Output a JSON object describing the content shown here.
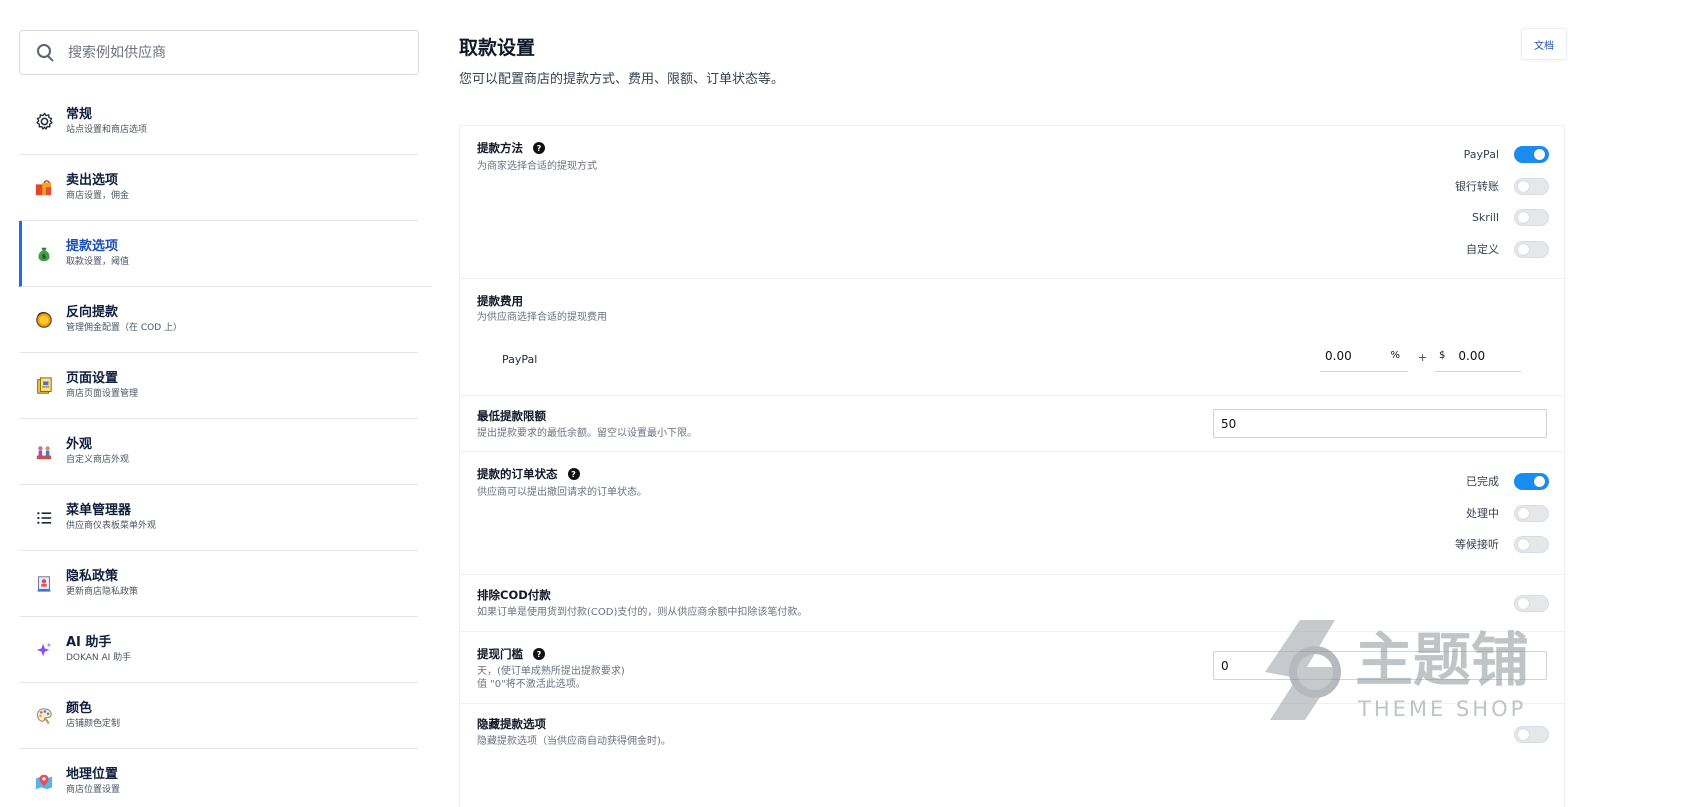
{
  "search": {
    "placeholder": "搜索例如供应商"
  },
  "sidebar": {
    "items": [
      {
        "title": "常规",
        "subtitle": "站点设置和商店选项",
        "icon": "gear-icon",
        "active": false
      },
      {
        "title": "卖出选项",
        "subtitle": "商店设置，佣金",
        "icon": "shopping-bags-icon",
        "active": false
      },
      {
        "title": "提款选项",
        "subtitle": "取款设置，阈值",
        "icon": "money-bag-icon",
        "active": true
      },
      {
        "title": "反向提款",
        "subtitle": "管理佣金配置（在 COD 上）",
        "icon": "coin-icon",
        "active": false
      },
      {
        "title": "页面设置",
        "subtitle": "商店页面设置管理",
        "icon": "pages-icon",
        "active": false
      },
      {
        "title": "外观",
        "subtitle": "自定义商店外观",
        "icon": "palette-people-icon",
        "active": false
      },
      {
        "title": "菜单管理器",
        "subtitle": "供应商仪表板菜单外观",
        "icon": "list-icon",
        "active": false
      },
      {
        "title": "隐私政策",
        "subtitle": "更新商店隐私政策",
        "icon": "privacy-icon",
        "active": false
      },
      {
        "title": "AI 助手",
        "subtitle": "DOKAN AI 助手",
        "icon": "sparkle-icon",
        "active": false
      },
      {
        "title": "颜色",
        "subtitle": "店铺颜色定制",
        "icon": "color-palette-icon",
        "active": false
      },
      {
        "title": "地理位置",
        "subtitle": "商店位置设置",
        "icon": "map-pin-icon",
        "active": false
      }
    ]
  },
  "header": {
    "title": "取款设置",
    "description": "您可以配置商店的提款方式、费用、限额、订单状态等。",
    "doc_button": "文档"
  },
  "sections": {
    "methods": {
      "title": "提款方法",
      "description": "为商家选择合适的提现方式",
      "options": [
        {
          "label": "PayPal",
          "enabled": true
        },
        {
          "label": "银行转账",
          "enabled": false
        },
        {
          "label": "Skrill",
          "enabled": false
        },
        {
          "label": "自定义",
          "enabled": false
        }
      ]
    },
    "fees": {
      "title": "提款费用",
      "description": "为供应商选择合适的提现费用",
      "rows": [
        {
          "method": "PayPal",
          "percent_value": "0.00",
          "percent_symbol": "%",
          "plus": "+",
          "currency_symbol": "$",
          "fixed_value": "0.00"
        }
      ]
    },
    "min_limit": {
      "title": "最低提款限额",
      "description": "提出提款要求的最低余额。留空以设置最小下限。",
      "value": "50"
    },
    "order_status": {
      "title": "提款的订单状态",
      "description": "供应商可以提出撤回请求的订单状态。",
      "options": [
        {
          "label": "已完成",
          "enabled": true
        },
        {
          "label": "处理中",
          "enabled": false
        },
        {
          "label": "等候接听",
          "enabled": false
        }
      ]
    },
    "exclude_cod": {
      "title": "排除COD付款",
      "description": "如果订单是使用货到付款(COD)支付的，则从供应商余额中扣除该笔付款。",
      "enabled": false
    },
    "threshold": {
      "title": "提现门槛",
      "description_line1": "天，(使订单成熟所提出提款要求)",
      "description_line2": "值 \"0\"将不激活此选项。",
      "value": "0"
    },
    "hide_options": {
      "title": "隐藏提款选项",
      "description": "隐藏提款选项（当供应商自动获得佣金时)。",
      "enabled": false
    }
  },
  "watermark": {
    "brand": "主题铺",
    "brand_en": "THEME SHOP"
  },
  "colors": {
    "accent": "#1a8cf0",
    "active_nav": "#1a6fe3",
    "toggle_off": "#e5e7eb"
  }
}
